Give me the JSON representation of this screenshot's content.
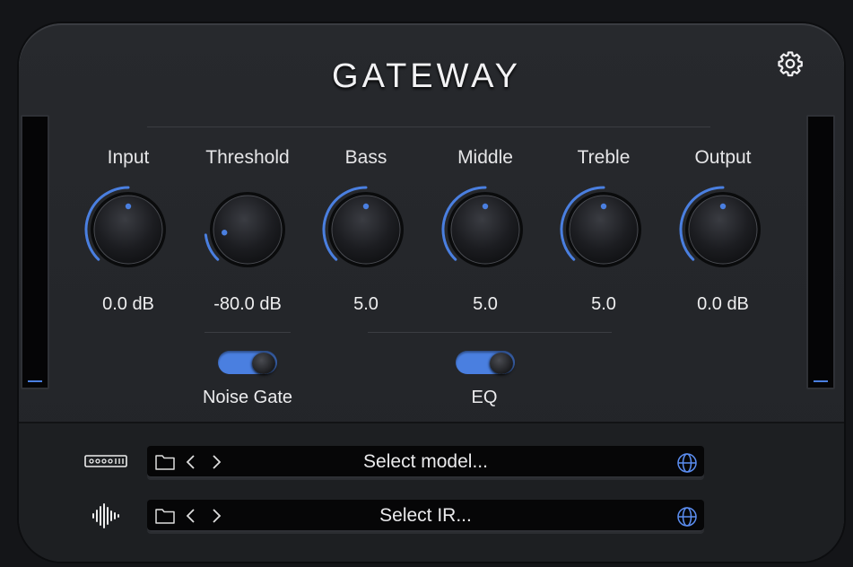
{
  "app": {
    "title": "GATEWAY"
  },
  "colors": {
    "accent": "#4a7fe0",
    "panel": "#25272b",
    "background": "#141518"
  },
  "knobs": [
    {
      "label": "Input",
      "value": "0.0 dB",
      "fraction": 0.5
    },
    {
      "label": "Threshold",
      "value": "-80.0 dB",
      "fraction": 0.14
    },
    {
      "label": "Bass",
      "value": "5.0",
      "fraction": 0.5
    },
    {
      "label": "Middle",
      "value": "5.0",
      "fraction": 0.5
    },
    {
      "label": "Treble",
      "value": "5.0",
      "fraction": 0.5
    },
    {
      "label": "Output",
      "value": "0.0 dB",
      "fraction": 0.5
    }
  ],
  "toggles": {
    "noise_gate": {
      "label": "Noise Gate",
      "on": true
    },
    "eq": {
      "label": "EQ",
      "on": true
    }
  },
  "meters": {
    "input_level": 0.0,
    "output_level": 0.0
  },
  "model_selector": {
    "placeholder": "Select model...",
    "icon": "amp-model-icon"
  },
  "ir_selector": {
    "placeholder": "Select IR...",
    "icon": "waveform-icon"
  },
  "icons": {
    "settings": "gear-icon",
    "folder": "folder-icon",
    "prev": "chevron-left-icon",
    "next": "chevron-right-icon",
    "globe": "globe-icon"
  }
}
